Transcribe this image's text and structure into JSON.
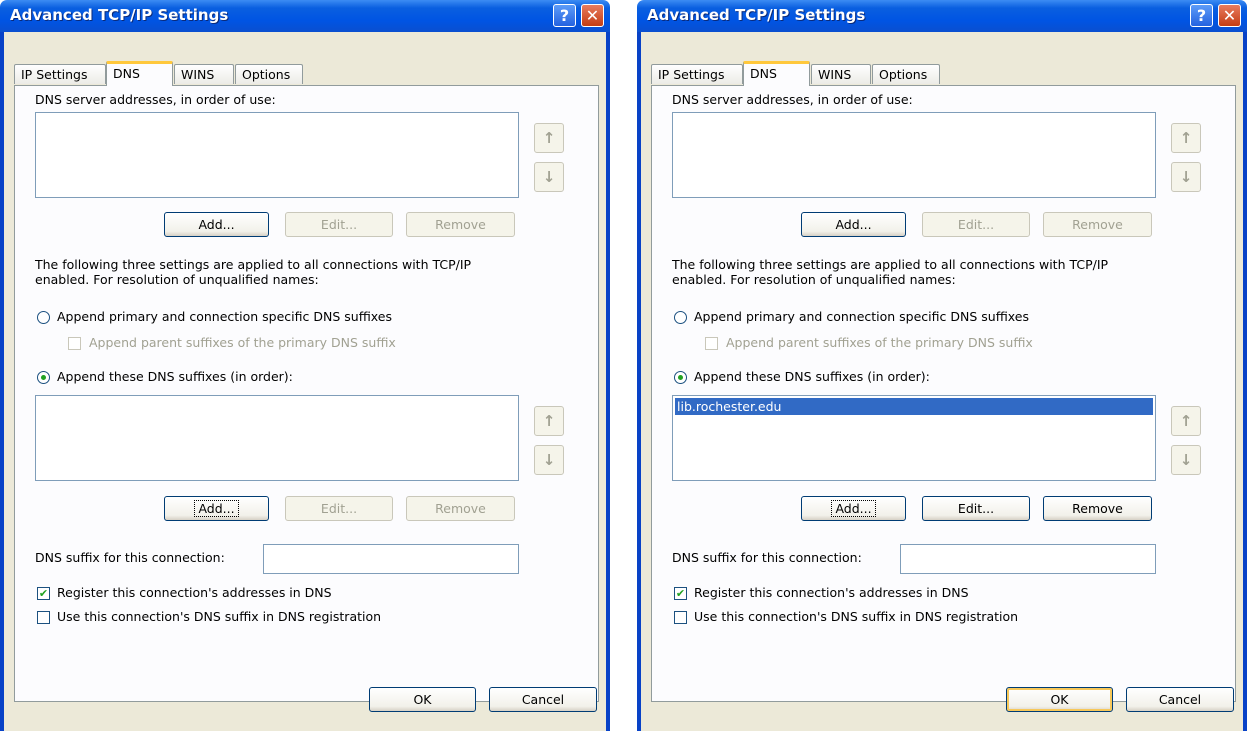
{
  "dialogs": [
    {
      "title": "Advanced TCP/IP Settings",
      "help_glyph": "?",
      "close_glyph": "✕",
      "tabs": [
        "IP Settings",
        "DNS",
        "WINS",
        "Options"
      ],
      "selected_tab": "DNS",
      "dns_servers_label": "DNS server addresses, in order of use:",
      "dns_servers": [],
      "up_arrow": "↑",
      "down_arrow": "↓",
      "add_label": "Add...",
      "edit_label": "Edit...",
      "remove_label": "Remove",
      "info_line1": "The following three settings are applied to all connections with TCP/IP",
      "info_line2": "enabled. For resolution of unqualified names:",
      "radio_primary_label": "Append primary and connection specific DNS suffixes",
      "checkbox_parent_label": "Append parent suffixes of the primary DNS suffix",
      "radio_these_label": "Append these DNS suffixes (in order):",
      "suffixes": [],
      "suffix_connection_label": "DNS suffix for this connection:",
      "suffix_connection_value": "",
      "register_label": "Register this connection's addresses in DNS",
      "register_checked": true,
      "use_suffix_label": "Use this connection's DNS suffix in DNS registration",
      "use_suffix_checked": false,
      "ok_label": "OK",
      "cancel_label": "Cancel"
    },
    {
      "title": "Advanced TCP/IP Settings",
      "help_glyph": "?",
      "close_glyph": "✕",
      "tabs": [
        "IP Settings",
        "DNS",
        "WINS",
        "Options"
      ],
      "selected_tab": "DNS",
      "dns_servers_label": "DNS server addresses, in order of use:",
      "dns_servers": [],
      "up_arrow": "↑",
      "down_arrow": "↓",
      "add_label": "Add...",
      "edit_label": "Edit...",
      "remove_label": "Remove",
      "info_line1": "The following three settings are applied to all connections with TCP/IP",
      "info_line2": "enabled. For resolution of unqualified names:",
      "radio_primary_label": "Append primary and connection specific DNS suffixes",
      "checkbox_parent_label": "Append parent suffixes of the primary DNS suffix",
      "radio_these_label": "Append these DNS suffixes (in order):",
      "suffixes": [
        "lib.rochester.edu"
      ],
      "suffix_connection_label": "DNS suffix for this connection:",
      "suffix_connection_value": "",
      "register_label": "Register this connection's addresses in DNS",
      "register_checked": true,
      "use_suffix_label": "Use this connection's DNS suffix in DNS registration",
      "use_suffix_checked": false,
      "ok_label": "OK",
      "cancel_label": "Cancel"
    }
  ]
}
